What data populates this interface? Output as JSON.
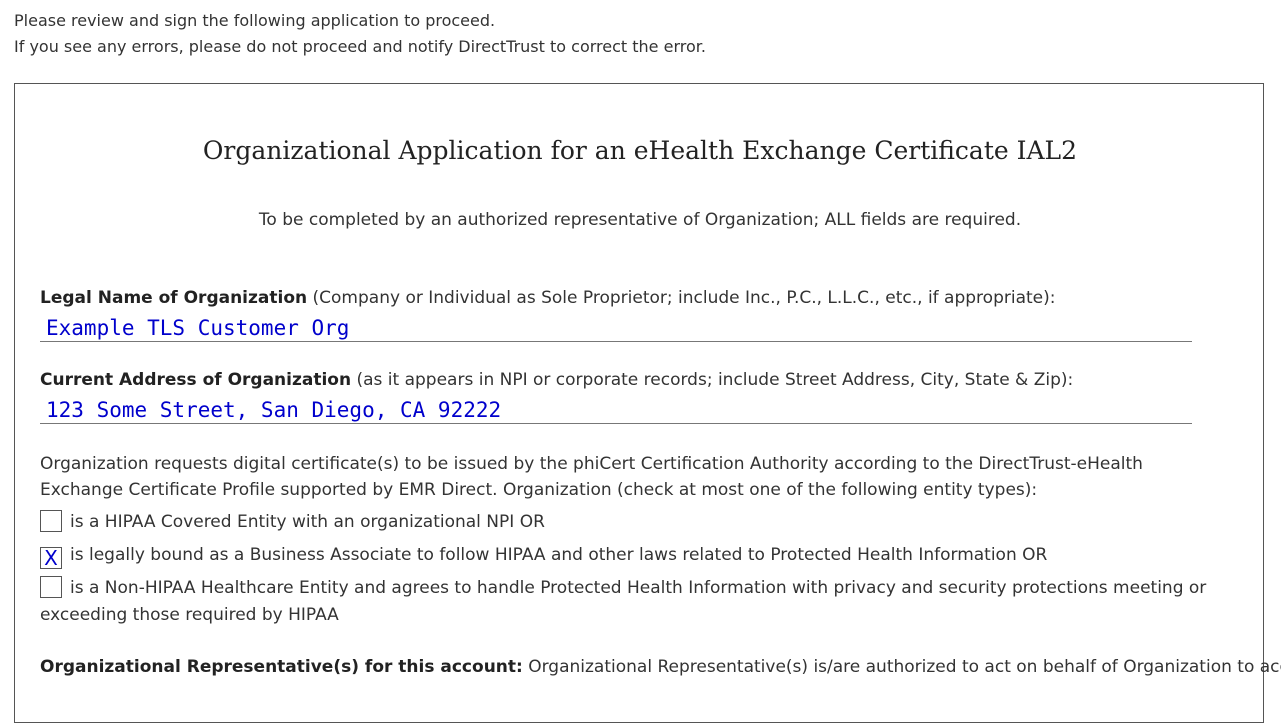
{
  "intro": {
    "line1": "Please review and sign the following application to proceed.",
    "line2": "If you see any errors, please do not proceed and notify DirectTrust to correct the error."
  },
  "form": {
    "title": "Organizational Application for an eHealth Exchange Certificate IAL2",
    "subtitle": "To be completed by an authorized representative of Organization; ALL fields are required.",
    "legal_name": {
      "label": "Legal Name of Organization",
      "hint": " (Company or Individual as Sole Proprietor; include Inc., P.C., L.L.C., etc., if appropriate):",
      "value": "Example TLS Customer Org"
    },
    "address": {
      "label": "Current Address of Organization",
      "hint": " (as it appears in NPI or corporate records; include Street Address, City, State & Zip):",
      "value": "123 Some Street, San Diego, CA 92222"
    },
    "entity_intro": "Organization requests digital certificate(s) to be issued by the phiCert Certification Authority according to the DirectTrust-eHealth Exchange Certificate Profile supported by EMR Direct. Organization (check at most one of the following entity types):",
    "entity_options": [
      {
        "mark": "",
        "label": "is a HIPAA Covered Entity with an organizational NPI OR"
      },
      {
        "mark": "X",
        "label": "is legally bound as a Business Associate to follow HIPAA and other laws related to Protected Health Information OR"
      },
      {
        "mark": "",
        "label": "is a Non-HIPAA Healthcare Entity and agrees to handle Protected Health Information with privacy and security protections meeting or exceeding those required by HIPAA"
      }
    ],
    "representatives": {
      "label": "Organizational Representative(s) for this account:",
      "text": " Organizational Representative(s) is/are authorized to act on behalf of Organization to accept"
    }
  }
}
